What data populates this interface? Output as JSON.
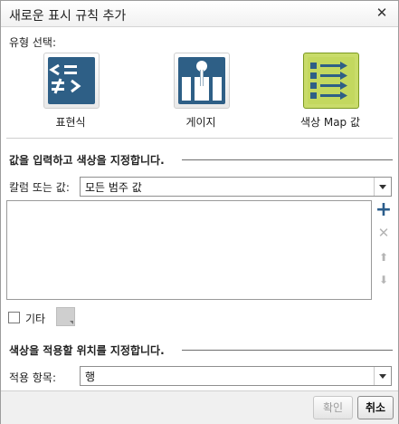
{
  "dialog": {
    "title": "새로운 표시 규칙 추가",
    "close_icon": "✕"
  },
  "type_select": {
    "label": "유형 선택:",
    "options": [
      {
        "label": "표현식",
        "icon": "expression-icon",
        "selected": false
      },
      {
        "label": "게이지",
        "icon": "gauge-icon",
        "selected": false
      },
      {
        "label": "색상 Map 값",
        "icon": "color-map-icon",
        "selected": true
      }
    ]
  },
  "values_section": {
    "title": "값을 입력하고 색상을 지정합니다.",
    "column_label": "칼럼 또는 값:",
    "column_value": "모든 범주 값",
    "add_label": "+",
    "remove_label": "✕",
    "move_up_label": "⬆",
    "move_down_label": "⬇",
    "other_label": "기타"
  },
  "apply_section": {
    "title": "색상을 적용할 위치를 지정합니다.",
    "apply_label": "적용 항목:",
    "apply_value": "행"
  },
  "footer": {
    "ok_label": "확인",
    "cancel_label": "취소"
  },
  "colors": {
    "accent_blue": "#2e5f86",
    "selected_green": "#c3d85f",
    "add_blue": "#2b5d8b"
  }
}
